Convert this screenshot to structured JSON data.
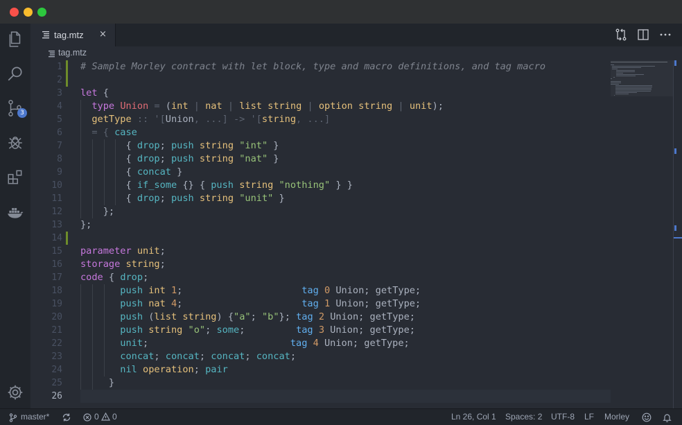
{
  "tab": {
    "name": "tag.mtz",
    "close": "×"
  },
  "breadcrumb": {
    "file": "tag.mtz"
  },
  "activity": {
    "scm_badge": "3"
  },
  "editor": {
    "line_numbers": [
      "1",
      "2",
      "3",
      "4",
      "5",
      "6",
      "7",
      "8",
      "9",
      "10",
      "11",
      "12",
      "13",
      "14",
      "15",
      "16",
      "17",
      "18",
      "19",
      "20",
      "21",
      "22",
      "23",
      "24",
      "25",
      "26"
    ],
    "lines": [
      [
        {
          "t": "# Sample Morley contract with let block, type and macro definitions, and tag macro",
          "c": "com"
        }
      ],
      [],
      [
        {
          "t": "let",
          "c": "kw"
        },
        {
          "t": " {",
          "c": ""
        }
      ],
      [
        {
          "t": "  ",
          "c": ""
        },
        {
          "t": "type",
          "c": "kw"
        },
        {
          "t": " ",
          "c": ""
        },
        {
          "t": "Union",
          "c": "red"
        },
        {
          "t": " = ",
          "c": "op"
        },
        {
          "t": "(",
          "c": ""
        },
        {
          "t": "int",
          "c": "ty"
        },
        {
          "t": " | ",
          "c": "op"
        },
        {
          "t": "nat",
          "c": "ty"
        },
        {
          "t": " | ",
          "c": "op"
        },
        {
          "t": "list",
          "c": "ty"
        },
        {
          "t": " ",
          "c": ""
        },
        {
          "t": "string",
          "c": "ty"
        },
        {
          "t": " | ",
          "c": "op"
        },
        {
          "t": "option",
          "c": "ty"
        },
        {
          "t": " ",
          "c": ""
        },
        {
          "t": "string",
          "c": "ty"
        },
        {
          "t": " | ",
          "c": "op"
        },
        {
          "t": "unit",
          "c": "ty"
        },
        {
          "t": ");",
          "c": ""
        }
      ],
      [
        {
          "t": "  ",
          "c": ""
        },
        {
          "t": "getType",
          "c": "ty"
        },
        {
          "t": " :: '[",
          "c": "op"
        },
        {
          "t": "Union",
          "c": ""
        },
        {
          "t": ", ...] -> '[",
          "c": "op"
        },
        {
          "t": "string",
          "c": "ty"
        },
        {
          "t": ", ...]",
          "c": "op"
        }
      ],
      [
        {
          "t": "  = { ",
          "c": "op"
        },
        {
          "t": "case",
          "c": "fn"
        }
      ],
      [
        {
          "t": "        { ",
          "c": ""
        },
        {
          "t": "drop",
          "c": "fn"
        },
        {
          "t": "; ",
          "c": ""
        },
        {
          "t": "push",
          "c": "fn"
        },
        {
          "t": " ",
          "c": ""
        },
        {
          "t": "string",
          "c": "ty"
        },
        {
          "t": " ",
          "c": ""
        },
        {
          "t": "\"int\"",
          "c": "str"
        },
        {
          "t": " }",
          "c": ""
        }
      ],
      [
        {
          "t": "        { ",
          "c": ""
        },
        {
          "t": "drop",
          "c": "fn"
        },
        {
          "t": "; ",
          "c": ""
        },
        {
          "t": "push",
          "c": "fn"
        },
        {
          "t": " ",
          "c": ""
        },
        {
          "t": "string",
          "c": "ty"
        },
        {
          "t": " ",
          "c": ""
        },
        {
          "t": "\"nat\"",
          "c": "str"
        },
        {
          "t": " }",
          "c": ""
        }
      ],
      [
        {
          "t": "        { ",
          "c": ""
        },
        {
          "t": "concat",
          "c": "fn"
        },
        {
          "t": " }",
          "c": ""
        }
      ],
      [
        {
          "t": "        { ",
          "c": ""
        },
        {
          "t": "if_some",
          "c": "fn"
        },
        {
          "t": " {} { ",
          "c": ""
        },
        {
          "t": "push",
          "c": "fn"
        },
        {
          "t": " ",
          "c": ""
        },
        {
          "t": "string",
          "c": "ty"
        },
        {
          "t": " ",
          "c": ""
        },
        {
          "t": "\"nothing\"",
          "c": "str"
        },
        {
          "t": " } }",
          "c": ""
        }
      ],
      [
        {
          "t": "        { ",
          "c": ""
        },
        {
          "t": "drop",
          "c": "fn"
        },
        {
          "t": "; ",
          "c": ""
        },
        {
          "t": "push",
          "c": "fn"
        },
        {
          "t": " ",
          "c": ""
        },
        {
          "t": "string",
          "c": "ty"
        },
        {
          "t": " ",
          "c": ""
        },
        {
          "t": "\"unit\"",
          "c": "str"
        },
        {
          "t": " }",
          "c": ""
        }
      ],
      [
        {
          "t": "    };",
          "c": ""
        }
      ],
      [
        {
          "t": "};",
          "c": ""
        }
      ],
      [],
      [
        {
          "t": "parameter",
          "c": "kw"
        },
        {
          "t": " ",
          "c": ""
        },
        {
          "t": "unit",
          "c": "ty"
        },
        {
          "t": ";",
          "c": ""
        }
      ],
      [
        {
          "t": "storage",
          "c": "kw"
        },
        {
          "t": " ",
          "c": ""
        },
        {
          "t": "string",
          "c": "ty"
        },
        {
          "t": ";",
          "c": ""
        }
      ],
      [
        {
          "t": "code",
          "c": "kw"
        },
        {
          "t": " { ",
          "c": ""
        },
        {
          "t": "drop",
          "c": "fn"
        },
        {
          "t": ";",
          "c": ""
        }
      ],
      [
        {
          "t": "       ",
          "c": ""
        },
        {
          "t": "push",
          "c": "fn"
        },
        {
          "t": " ",
          "c": ""
        },
        {
          "t": "int",
          "c": "ty"
        },
        {
          "t": " ",
          "c": ""
        },
        {
          "t": "1",
          "c": "num"
        },
        {
          "t": ";                     ",
          "c": ""
        },
        {
          "t": "tag",
          "c": "tag"
        },
        {
          "t": " ",
          "c": ""
        },
        {
          "t": "0",
          "c": "num"
        },
        {
          "t": " Union; getType;",
          "c": ""
        }
      ],
      [
        {
          "t": "       ",
          "c": ""
        },
        {
          "t": "push",
          "c": "fn"
        },
        {
          "t": " ",
          "c": ""
        },
        {
          "t": "nat",
          "c": "ty"
        },
        {
          "t": " ",
          "c": ""
        },
        {
          "t": "4",
          "c": "num"
        },
        {
          "t": ";                     ",
          "c": ""
        },
        {
          "t": "tag",
          "c": "tag"
        },
        {
          "t": " ",
          "c": ""
        },
        {
          "t": "1",
          "c": "num"
        },
        {
          "t": " Union; getType;",
          "c": ""
        }
      ],
      [
        {
          "t": "       ",
          "c": ""
        },
        {
          "t": "push",
          "c": "fn"
        },
        {
          "t": " (",
          "c": ""
        },
        {
          "t": "list",
          "c": "ty"
        },
        {
          "t": " ",
          "c": ""
        },
        {
          "t": "string",
          "c": "ty"
        },
        {
          "t": ") {",
          "c": ""
        },
        {
          "t": "\"a\"",
          "c": "str"
        },
        {
          "t": "; ",
          "c": ""
        },
        {
          "t": "\"b\"",
          "c": "str"
        },
        {
          "t": "}; ",
          "c": ""
        },
        {
          "t": "tag",
          "c": "tag"
        },
        {
          "t": " ",
          "c": ""
        },
        {
          "t": "2",
          "c": "num"
        },
        {
          "t": " Union; getType;",
          "c": ""
        }
      ],
      [
        {
          "t": "       ",
          "c": ""
        },
        {
          "t": "push",
          "c": "fn"
        },
        {
          "t": " ",
          "c": ""
        },
        {
          "t": "string",
          "c": "ty"
        },
        {
          "t": " ",
          "c": ""
        },
        {
          "t": "\"o\"",
          "c": "str"
        },
        {
          "t": "; ",
          "c": ""
        },
        {
          "t": "some",
          "c": "fn"
        },
        {
          "t": ";         ",
          "c": ""
        },
        {
          "t": "tag",
          "c": "tag"
        },
        {
          "t": " ",
          "c": ""
        },
        {
          "t": "3",
          "c": "num"
        },
        {
          "t": " Union; getType;",
          "c": ""
        }
      ],
      [
        {
          "t": "       ",
          "c": ""
        },
        {
          "t": "unit",
          "c": "fn"
        },
        {
          "t": ";                         ",
          "c": ""
        },
        {
          "t": "tag",
          "c": "tag"
        },
        {
          "t": " ",
          "c": ""
        },
        {
          "t": "4",
          "c": "num"
        },
        {
          "t": " Union; getType;",
          "c": ""
        }
      ],
      [
        {
          "t": "       ",
          "c": ""
        },
        {
          "t": "concat",
          "c": "fn"
        },
        {
          "t": "; ",
          "c": ""
        },
        {
          "t": "concat",
          "c": "fn"
        },
        {
          "t": "; ",
          "c": ""
        },
        {
          "t": "concat",
          "c": "fn"
        },
        {
          "t": "; ",
          "c": ""
        },
        {
          "t": "concat",
          "c": "fn"
        },
        {
          "t": ";",
          "c": ""
        }
      ],
      [
        {
          "t": "       ",
          "c": ""
        },
        {
          "t": "nil",
          "c": "fn"
        },
        {
          "t": " ",
          "c": ""
        },
        {
          "t": "operation",
          "c": "ty"
        },
        {
          "t": "; ",
          "c": ""
        },
        {
          "t": "pair",
          "c": "fn"
        }
      ],
      [
        {
          "t": "     }",
          "c": ""
        }
      ],
      []
    ]
  },
  "status": {
    "branch": "master*",
    "errors": "0",
    "warnings": "0",
    "position": "Ln 26, Col 1",
    "spaces": "Spaces: 2",
    "encoding": "UTF-8",
    "eol": "LF",
    "language": "Morley"
  },
  "colors": {
    "accent": "#4d78cc",
    "git_added": "#6e8c2a",
    "keyword": "#c678dd",
    "type": "#e5c07b",
    "function": "#56b6c2",
    "string": "#98c379"
  },
  "icons": [
    "files-icon",
    "search-icon",
    "source-control-icon",
    "debug-icon",
    "extensions-icon",
    "docker-icon",
    "gear-icon",
    "compare-changes-icon",
    "split-editor-icon",
    "more-actions-icon",
    "git-branch-icon",
    "sync-icon",
    "error-icon",
    "warning-icon",
    "feedback-icon",
    "bell-icon"
  ]
}
